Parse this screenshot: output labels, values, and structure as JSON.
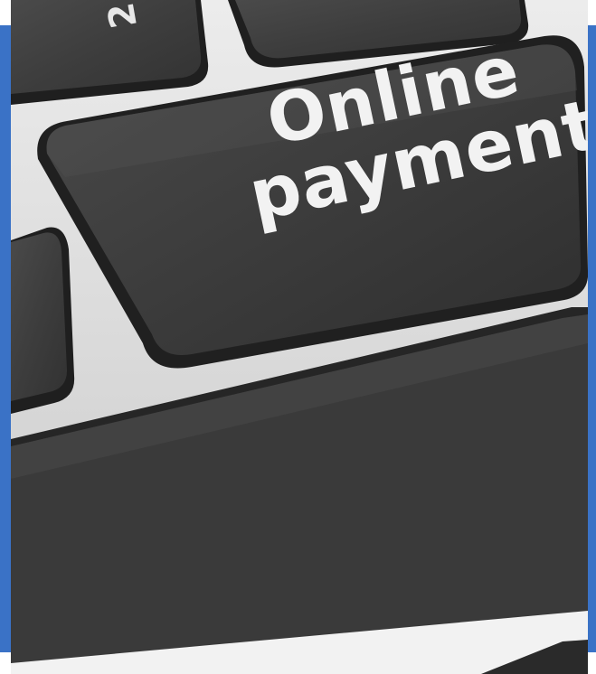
{
  "image": {
    "kind": "photo",
    "subject": "keyboard",
    "key_label": {
      "line1": "Online",
      "line2": "payment"
    },
    "corner_key_glyph": "2"
  },
  "colors": {
    "frame_accent": "#3a72c6",
    "key_face": "#3c3c3c",
    "key_edge": "#262626",
    "keyboard_body": "#dcdcdc",
    "label_text": "#f2f2f2"
  }
}
